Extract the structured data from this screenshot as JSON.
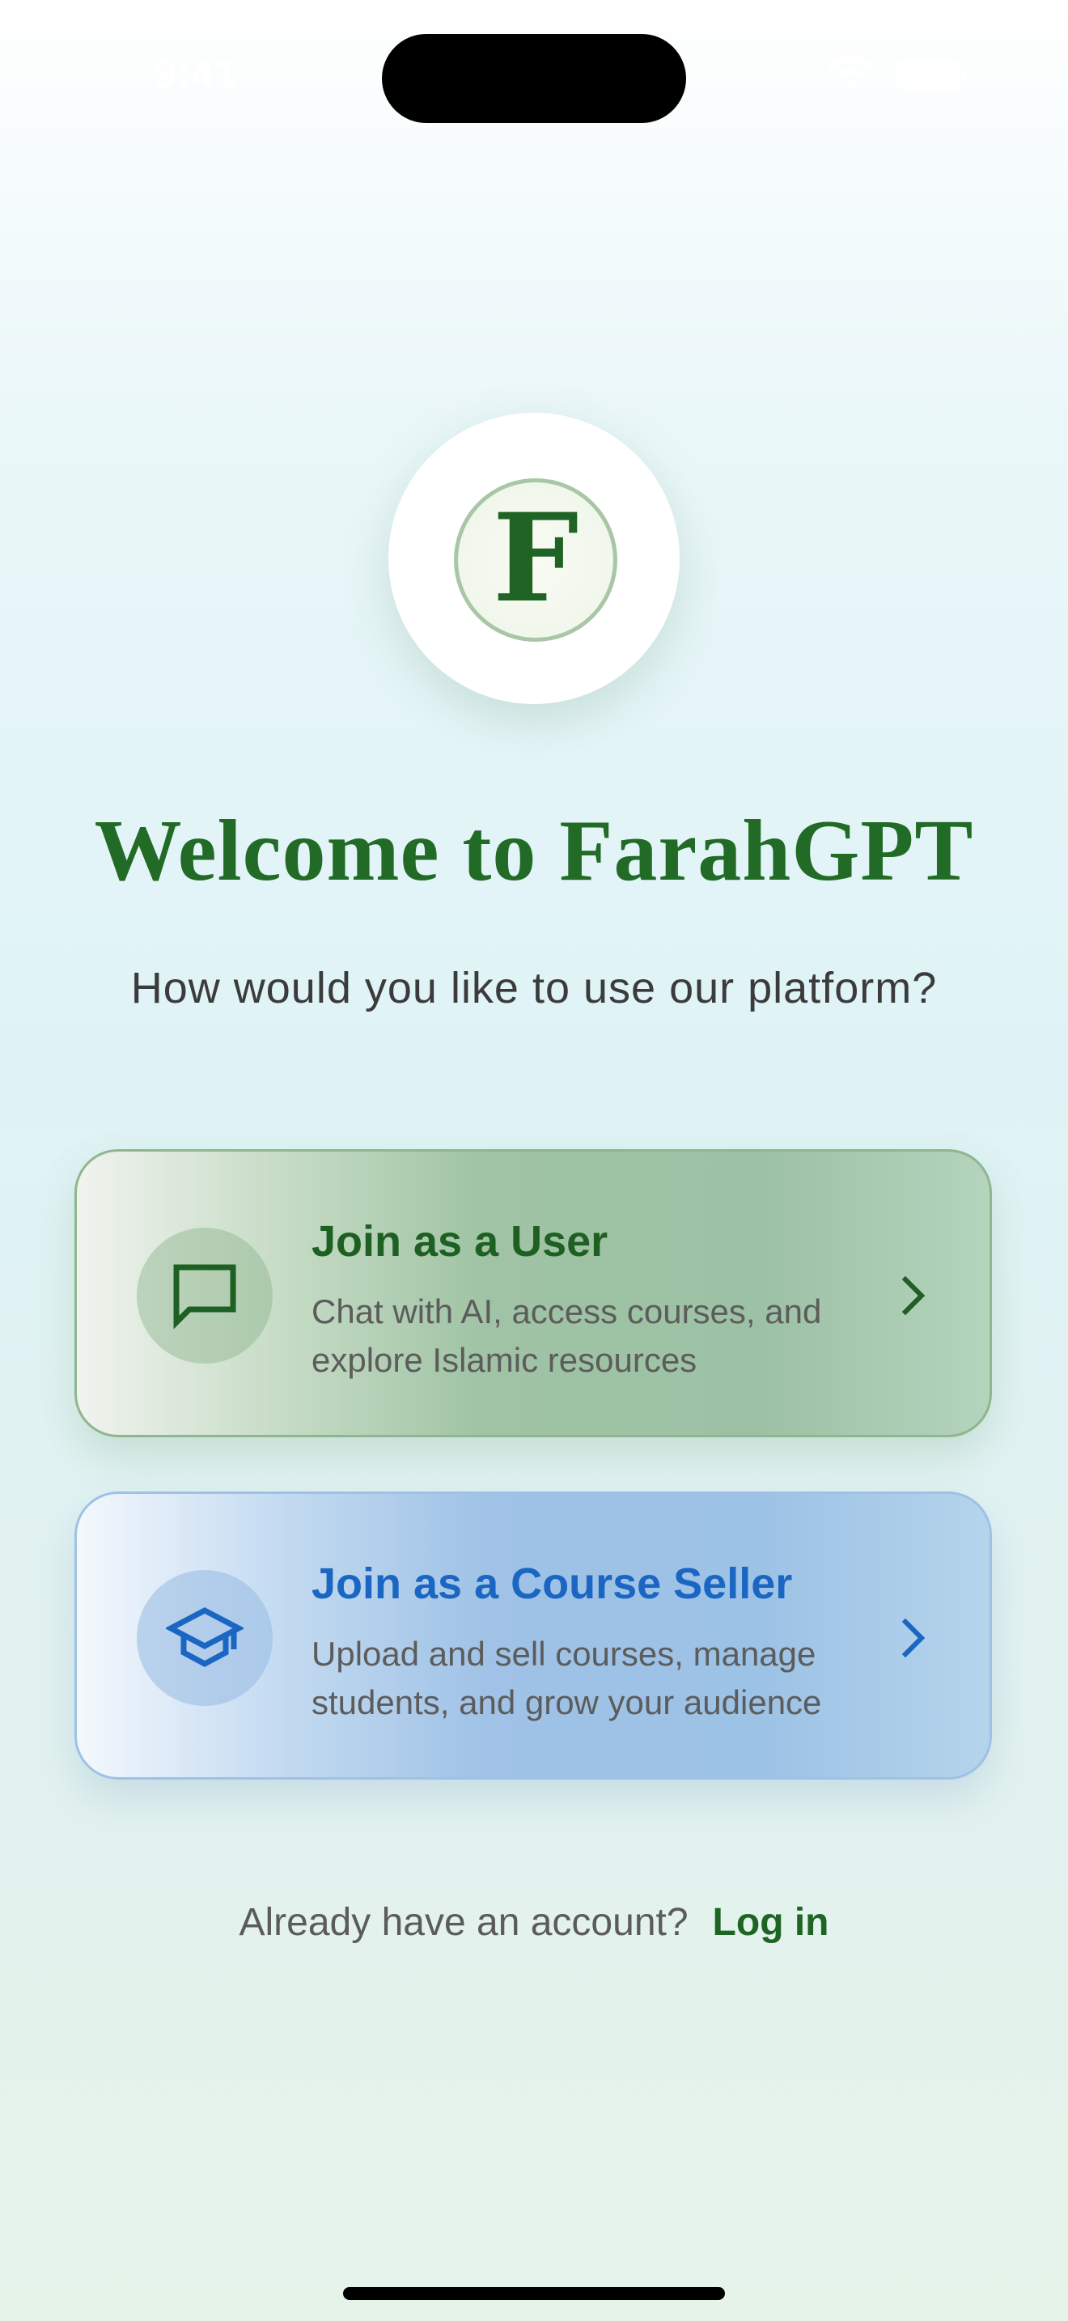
{
  "status_bar": {
    "time": "9:41"
  },
  "logo": {
    "letter": "F"
  },
  "header": {
    "title": "Welcome to FarahGPT",
    "subtitle": "How would you like to use our platform?"
  },
  "options": [
    {
      "title": "Join as a User",
      "description": "Chat with AI, access courses, and explore Islamic resources",
      "icon": "chat-bubble-icon",
      "accent": "#1e6022"
    },
    {
      "title": "Join as a Course Seller",
      "description": "Upload and sell courses, manage students, and grow your audience",
      "icon": "graduation-cap-icon",
      "accent": "#1a66c2"
    }
  ],
  "login": {
    "prompt": "Already have an account?",
    "link_label": "Log in"
  },
  "colors": {
    "brand_green": "#226b27",
    "seller_blue": "#1a66c2"
  }
}
